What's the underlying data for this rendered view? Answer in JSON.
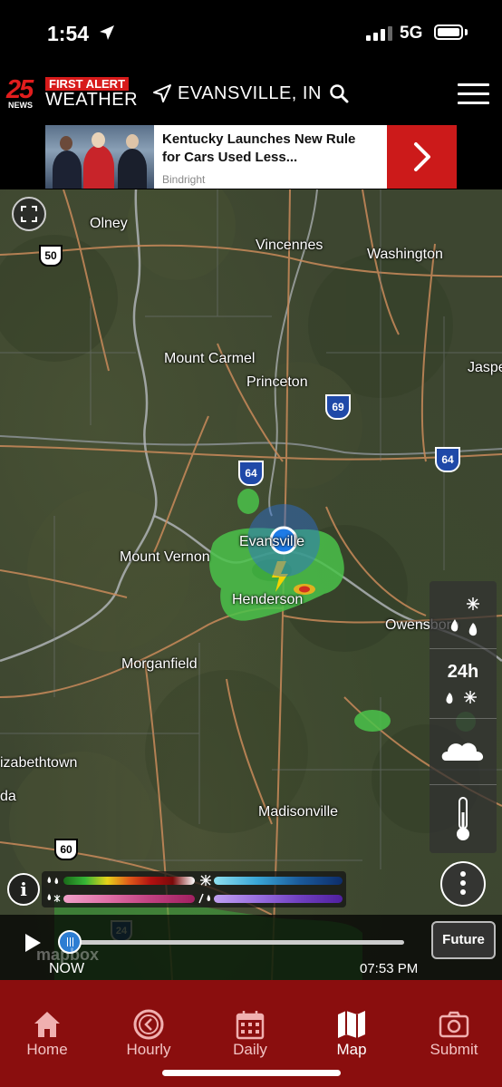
{
  "status_bar": {
    "time": "1:54",
    "network": "5G"
  },
  "header": {
    "logo": {
      "number": "25",
      "news": "NEWS",
      "first_alert": "FIRST ALERT",
      "weather": "WEATHER"
    },
    "location": "EVANSVILLE, IN"
  },
  "ad": {
    "title": "Kentucky Launches New Rule for Cars Used Less...",
    "source": "Bindright"
  },
  "map": {
    "cities": [
      {
        "name": "Olney"
      },
      {
        "name": "Vincennes"
      },
      {
        "name": "Washington"
      },
      {
        "name": "Mount Carmel"
      },
      {
        "name": "Princeton"
      },
      {
        "name": "Jaspe"
      },
      {
        "name": "Evansville"
      },
      {
        "name": "Mount Vernon"
      },
      {
        "name": "Henderson"
      },
      {
        "name": "Owensboro"
      },
      {
        "name": "Morganfield"
      },
      {
        "name": "izabethtown"
      },
      {
        "name": "da"
      },
      {
        "name": "Madisonville"
      }
    ],
    "shields": [
      {
        "number": "50",
        "type": "us"
      },
      {
        "number": "69",
        "type": "interstate"
      },
      {
        "number": "64",
        "type": "interstate"
      },
      {
        "number": "64",
        "type": "interstate"
      },
      {
        "number": "60",
        "type": "us"
      },
      {
        "number": "24",
        "type": "interstate"
      }
    ],
    "side_panel": {
      "timespan_label": "24h"
    },
    "watermark": "mapbox"
  },
  "timeline": {
    "start_label": "NOW",
    "end_label": "07:53 PM",
    "future_label": "Future",
    "progress": 0
  },
  "tabs": [
    {
      "label": "Home",
      "icon": "home-icon",
      "active": false
    },
    {
      "label": "Hourly",
      "icon": "clock-back-icon",
      "active": false
    },
    {
      "label": "Daily",
      "icon": "calendar-icon",
      "active": false
    },
    {
      "label": "Map",
      "icon": "map-icon",
      "active": true
    },
    {
      "label": "Submit",
      "icon": "camera-icon",
      "active": false
    }
  ],
  "colors": {
    "tab_bar": "#8a0e0e",
    "accent_red": "#cc1a1a",
    "location_dot": "#1e7be6"
  }
}
